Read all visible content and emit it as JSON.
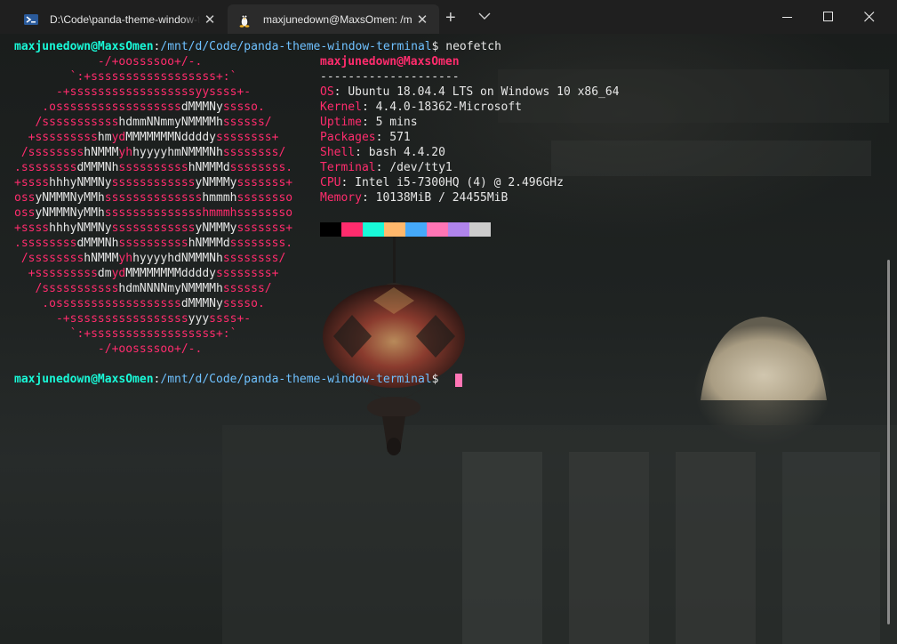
{
  "tabs": [
    {
      "title": "D:\\Code\\panda-theme-window-terminal",
      "icon": "powershell-icon",
      "active": false
    },
    {
      "title": "maxjunedown@MaxsOmen: /mnt/d/Code/panda-theme-window-terminal",
      "icon": "tux-linux-icon",
      "active": true
    }
  ],
  "toolbar": {
    "new_tab": "+",
    "close_glyph": "✕"
  },
  "prompt": {
    "user_host": "maxjunedown@MaxsOmen",
    "colon": ":",
    "path": "/mnt/d/Code/panda-theme-window-terminal",
    "symbol": "$",
    "command": " neofetch"
  },
  "ascii_logo": [
    [
      [
        "pk",
        "            -/+oossssoo+/-."
      ]
    ],
    [
      [
        "pk",
        "        `:+ssssssssssssssssss+:`"
      ]
    ],
    [
      [
        "pk",
        "      -+ssssssssssssssssssyyssss+-"
      ]
    ],
    [
      [
        "pk",
        "    .ossssssssssssssssss"
      ],
      [
        "wh",
        "dMMMNy"
      ],
      [
        "pk",
        "sssso."
      ]
    ],
    [
      [
        "pk",
        "   /sssssssssss"
      ],
      [
        "wh",
        "hdmmNNmmyNMMMMh"
      ],
      [
        "pk",
        "ssssss/"
      ]
    ],
    [
      [
        "pk",
        "  +sssssssss"
      ],
      [
        "wh",
        "hm"
      ],
      [
        "pk",
        "yd"
      ],
      [
        "wh",
        "MMMMMMMNddddy"
      ],
      [
        "pk",
        "ssssssss+"
      ]
    ],
    [
      [
        "pk",
        " /ssssssss"
      ],
      [
        "wh",
        "hNMMM"
      ],
      [
        "pk",
        "yh"
      ],
      [
        "wh",
        "hyyyyhmNMMMNh"
      ],
      [
        "pk",
        "ssssssss/"
      ]
    ],
    [
      [
        "pk",
        ".ssssssss"
      ],
      [
        "wh",
        "dMMMNh"
      ],
      [
        "pk",
        "ssssssssss"
      ],
      [
        "wh",
        "hNMMMd"
      ],
      [
        "pk",
        "ssssssss."
      ]
    ],
    [
      [
        "pk",
        "+ssss"
      ],
      [
        "wh",
        "hhhyNMMNy"
      ],
      [
        "pk",
        "ssssssssssss"
      ],
      [
        "wh",
        "yNMMMy"
      ],
      [
        "pk",
        "sssssss+"
      ]
    ],
    [
      [
        "pk",
        "oss"
      ],
      [
        "wh",
        "yNMMMNyMMh"
      ],
      [
        "pk",
        "ssssssssssssss"
      ],
      [
        "wh",
        "hmmmh"
      ],
      [
        "pk",
        "ssssssso"
      ]
    ],
    [
      [
        "pk",
        "oss"
      ],
      [
        "wh",
        "yNMMMNyMMh"
      ],
      [
        "pk",
        "sssssssssssssshmmmhssssssso"
      ]
    ],
    [
      [
        "pk",
        "+ssss"
      ],
      [
        "wh",
        "hhhyNMMNy"
      ],
      [
        "pk",
        "ssssssssssss"
      ],
      [
        "wh",
        "yNMMMy"
      ],
      [
        "pk",
        "sssssss+"
      ]
    ],
    [
      [
        "pk",
        ".ssssssss"
      ],
      [
        "wh",
        "dMMMNh"
      ],
      [
        "pk",
        "ssssssssss"
      ],
      [
        "wh",
        "hNMMMd"
      ],
      [
        "pk",
        "ssssssss."
      ]
    ],
    [
      [
        "pk",
        " /ssssssss"
      ],
      [
        "wh",
        "hNMMM"
      ],
      [
        "pk",
        "yh"
      ],
      [
        "wh",
        "hyyyyhdNMMMNh"
      ],
      [
        "pk",
        "ssssssss/"
      ]
    ],
    [
      [
        "pk",
        "  +sssssssss"
      ],
      [
        "wh",
        "dm"
      ],
      [
        "pk",
        "yd"
      ],
      [
        "wh",
        "MMMMMMMMddddy"
      ],
      [
        "pk",
        "ssssssss+"
      ]
    ],
    [
      [
        "pk",
        "   /sssssssssss"
      ],
      [
        "wh",
        "hdmNNNNmyNMMMMh"
      ],
      [
        "pk",
        "ssssss/"
      ]
    ],
    [
      [
        "pk",
        "    .ossssssssssssssssss"
      ],
      [
        "wh",
        "dMMMNy"
      ],
      [
        "pk",
        "sssso."
      ]
    ],
    [
      [
        "pk",
        "      -+sssssssssssssssss"
      ],
      [
        "wh",
        "yyy"
      ],
      [
        "pk",
        "ssss+-"
      ]
    ],
    [
      [
        "pk",
        "        `:+ssssssssssssssssss+:`"
      ]
    ],
    [
      [
        "pk",
        "            -/+oossssoo+/-."
      ]
    ]
  ],
  "info": {
    "title": "maxjunedown@MaxsOmen",
    "separator": "--------------------",
    "rows": [
      {
        "key": "OS",
        "value": "Ubuntu 18.04.4 LTS on Windows 10 x86_64"
      },
      {
        "key": "Kernel",
        "value": "4.4.0-18362-Microsoft"
      },
      {
        "key": "Uptime",
        "value": "5 mins"
      },
      {
        "key": "Packages",
        "value": "571"
      },
      {
        "key": "Shell",
        "value": "bash 4.4.20"
      },
      {
        "key": "Terminal",
        "value": "/dev/tty1"
      },
      {
        "key": "CPU",
        "value": "Intel i5-7300HQ (4) @ 2.496GHz"
      },
      {
        "key": "Memory",
        "value": "10138MiB / 24455MiB"
      }
    ]
  },
  "palette": [
    "#000000",
    "#ff2c6d",
    "#19f9d8",
    "#ffb86c",
    "#45a9f9",
    "#ff75b5",
    "#b084eb",
    "#cccccc"
  ],
  "colors": {
    "user": "#19f9d8",
    "path": "#6fc1ff",
    "accent": "#ff2c6d",
    "text": "#e6e6e6",
    "cursor": "#ff75b5"
  }
}
